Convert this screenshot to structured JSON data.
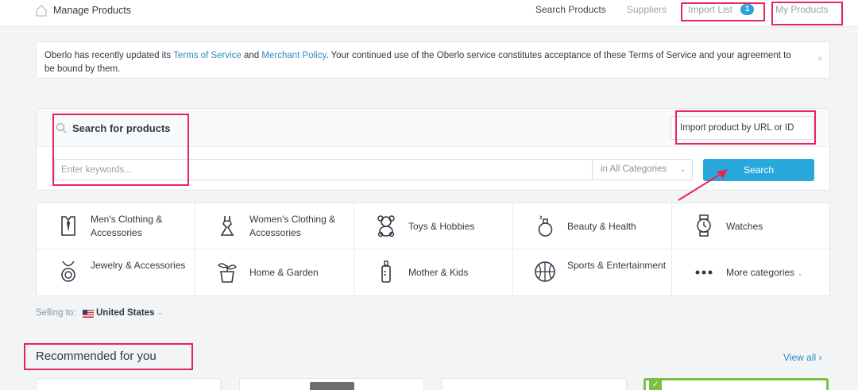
{
  "topbar": {
    "brand": "Manage Products",
    "nav": [
      {
        "label": "Search Products"
      },
      {
        "label": "Suppliers"
      },
      {
        "label": "Import List",
        "badge": "1"
      },
      {
        "label": "My Products"
      }
    ]
  },
  "notice": {
    "prefix": "Oberlo has recently updated its ",
    "tos_link": "Terms of Service",
    "and": " and ",
    "merchant_link": "Merchant Policy",
    "suffix": ". Your continued use of the Oberlo service constitutes acceptance of these Terms of Service and your agreement to be bound by them.",
    "close": "×"
  },
  "search": {
    "title": "Search for products",
    "import_label": "Import product by URL or ID",
    "placeholder": "Enter keywords...",
    "category": "in All Categories",
    "button": "Search"
  },
  "categories": [
    {
      "label": "Men's Clothing & Accessories",
      "icon": "shirt-icon"
    },
    {
      "label": "Women's Clothing & Accessories",
      "icon": "dress-icon"
    },
    {
      "label": "Toys & Hobbies",
      "icon": "teddy-bear-icon"
    },
    {
      "label": "Beauty & Health",
      "icon": "perfume-icon"
    },
    {
      "label": "Watches",
      "icon": "watch-icon"
    },
    {
      "label": "Jewelry & Accessories",
      "icon": "necklace-icon"
    },
    {
      "label": "Home & Garden",
      "icon": "plant-icon"
    },
    {
      "label": "Mother & Kids",
      "icon": "baby-bottle-icon"
    },
    {
      "label": "Sports & Entertainment",
      "icon": "ball-icon"
    },
    {
      "label": "More categories",
      "icon": "more-dots-icon"
    }
  ],
  "selling": {
    "label": "Selling to:",
    "country": "United States"
  },
  "recommended": {
    "title": "Recommended for you",
    "view_all": "View all"
  },
  "colors": {
    "accent": "#29a8dc",
    "link": "#2f8ac4",
    "highlight": "#e8245a",
    "selected": "#7ac143"
  }
}
